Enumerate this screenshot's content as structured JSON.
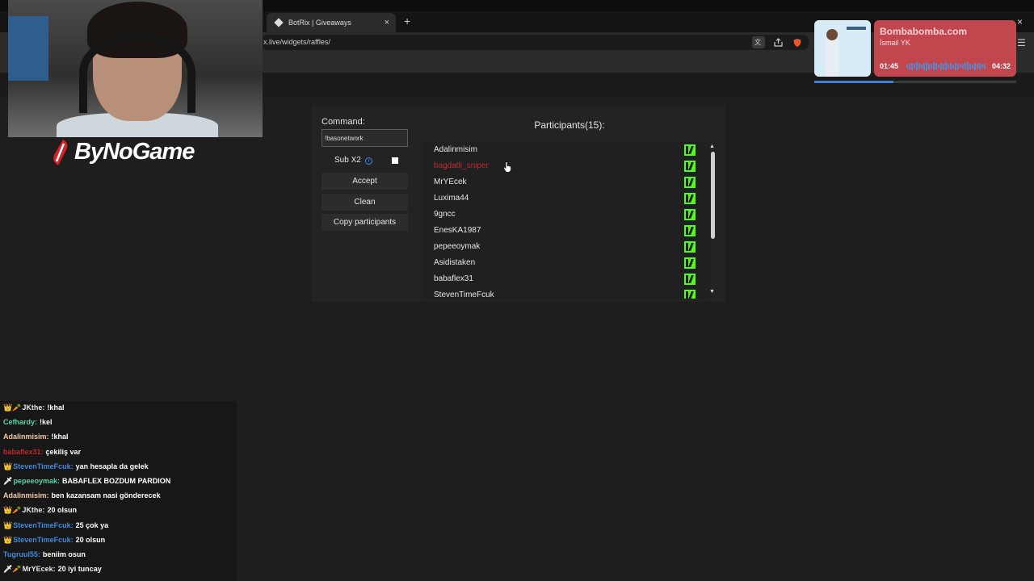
{
  "browser": {
    "tab_title": "BotRix | Giveaways",
    "tab_close": "×",
    "new_tab": "+",
    "url": "x.live/widgets/raffles/"
  },
  "widget": {
    "command_label": "Command:",
    "command_value": "!basonetwork",
    "sub_label": "Sub X2",
    "info_glyph": "i",
    "buttons": {
      "accept": "Accept",
      "clean": "Clean",
      "copy": "Copy participants"
    },
    "participants_title": "Participants(15):",
    "participants": [
      {
        "name": "Adalinmisim",
        "color": "#e6e6e6"
      },
      {
        "name": "bagdatli_sniper",
        "color": "#c0282d"
      },
      {
        "name": "MrYEcek",
        "color": "#e6e6e6"
      },
      {
        "name": "Luxima44",
        "color": "#e6e6e6"
      },
      {
        "name": "9gncc",
        "color": "#e6e6e6"
      },
      {
        "name": "EnesKA1987",
        "color": "#e6e6e6"
      },
      {
        "name": "pepeeoymak",
        "color": "#e6e6e6"
      },
      {
        "name": "Asidistaken",
        "color": "#e6e6e6"
      },
      {
        "name": "babaflex31",
        "color": "#e6e6e6"
      },
      {
        "name": "StevenTimeFcuk",
        "color": "#e6e6e6"
      }
    ],
    "platform_icon": "kick-icon",
    "scroll_up": "▲",
    "scroll_down": "▼"
  },
  "brand": {
    "logo_text": "ByNoGame"
  },
  "music": {
    "title": "Bombabomba.com",
    "artist": "İsmail YK",
    "time_current": "01:45",
    "time_total": "04:32",
    "progress": 0.39,
    "close": "×",
    "menu": "☰"
  },
  "chat": [
    {
      "badge": "👑🥕",
      "user": "JKthe:",
      "color": "#e6e6e6",
      "msg": "!khal"
    },
    {
      "badge": "",
      "user": "Cefhardy:",
      "color": "#5bd4a6",
      "msg": "!kel"
    },
    {
      "badge": "",
      "user": "Adalinmisim:",
      "color": "#f0c9a7",
      "msg": "!khal"
    },
    {
      "badge": "",
      "user": "babaflex31:",
      "color": "#c0282d",
      "msg": "çekiliş var"
    },
    {
      "badge": "👑",
      "user": "StevenTimeFcuk:",
      "color": "#3f8be0",
      "msg": "yan hesapla da gelek"
    },
    {
      "badge": "🗡",
      "user": "pepeeoymak:",
      "color": "#5bd4a6",
      "msg": "BABAFLEX BOZDUM PARDION"
    },
    {
      "badge": "",
      "user": "Adalinmisim:",
      "color": "#f0c9a7",
      "msg": "ben kazansam nasi gönderecek"
    },
    {
      "badge": "👑🥕",
      "user": "JKthe:",
      "color": "#e6e6e6",
      "msg": "20 olsun"
    },
    {
      "badge": "👑",
      "user": "StevenTimeFcuk:",
      "color": "#3f8be0",
      "msg": "25 çok ya"
    },
    {
      "badge": "👑",
      "user": "StevenTimeFcuk:",
      "color": "#3f8be0",
      "msg": "20 olsun"
    },
    {
      "badge": "",
      "user": "Tugruul55:",
      "color": "#3f8be0",
      "msg": "beniim osun"
    },
    {
      "badge": "🗡🥕",
      "user": "MrYEcek:",
      "color": "#e6e6e6",
      "msg": "20 iyi tuncay"
    }
  ],
  "colors": {
    "kick_green": "#53fc18",
    "music_card": "#c2464e",
    "music_progress": "#3b7fd9"
  }
}
